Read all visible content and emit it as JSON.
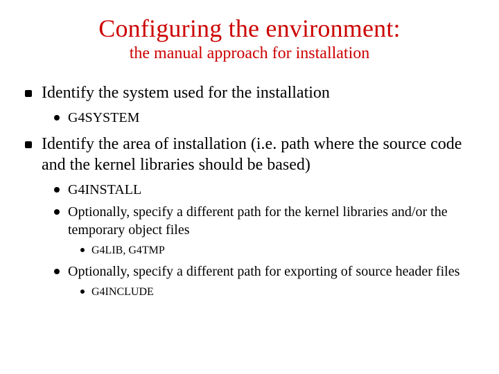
{
  "title": "Configuring the environment:",
  "subtitle": "the manual approach for installation",
  "items": [
    {
      "text": "Identify the system used for the installation",
      "children": [
        {
          "text": "G4SYSTEM"
        }
      ]
    },
    {
      "text": "Identify the area of installation (i.e. path where the source code and the kernel libraries should be based)",
      "children": [
        {
          "text": "G4INSTALL"
        },
        {
          "text": "Optionally, specify a different path for the kernel libraries and/or the temporary object files",
          "children": [
            {
              "text": "G4LIB, G4TMP"
            }
          ]
        },
        {
          "text": "Optionally, specify a different path for exporting of source header files",
          "children": [
            {
              "text": "G4INCLUDE"
            }
          ]
        }
      ]
    }
  ]
}
